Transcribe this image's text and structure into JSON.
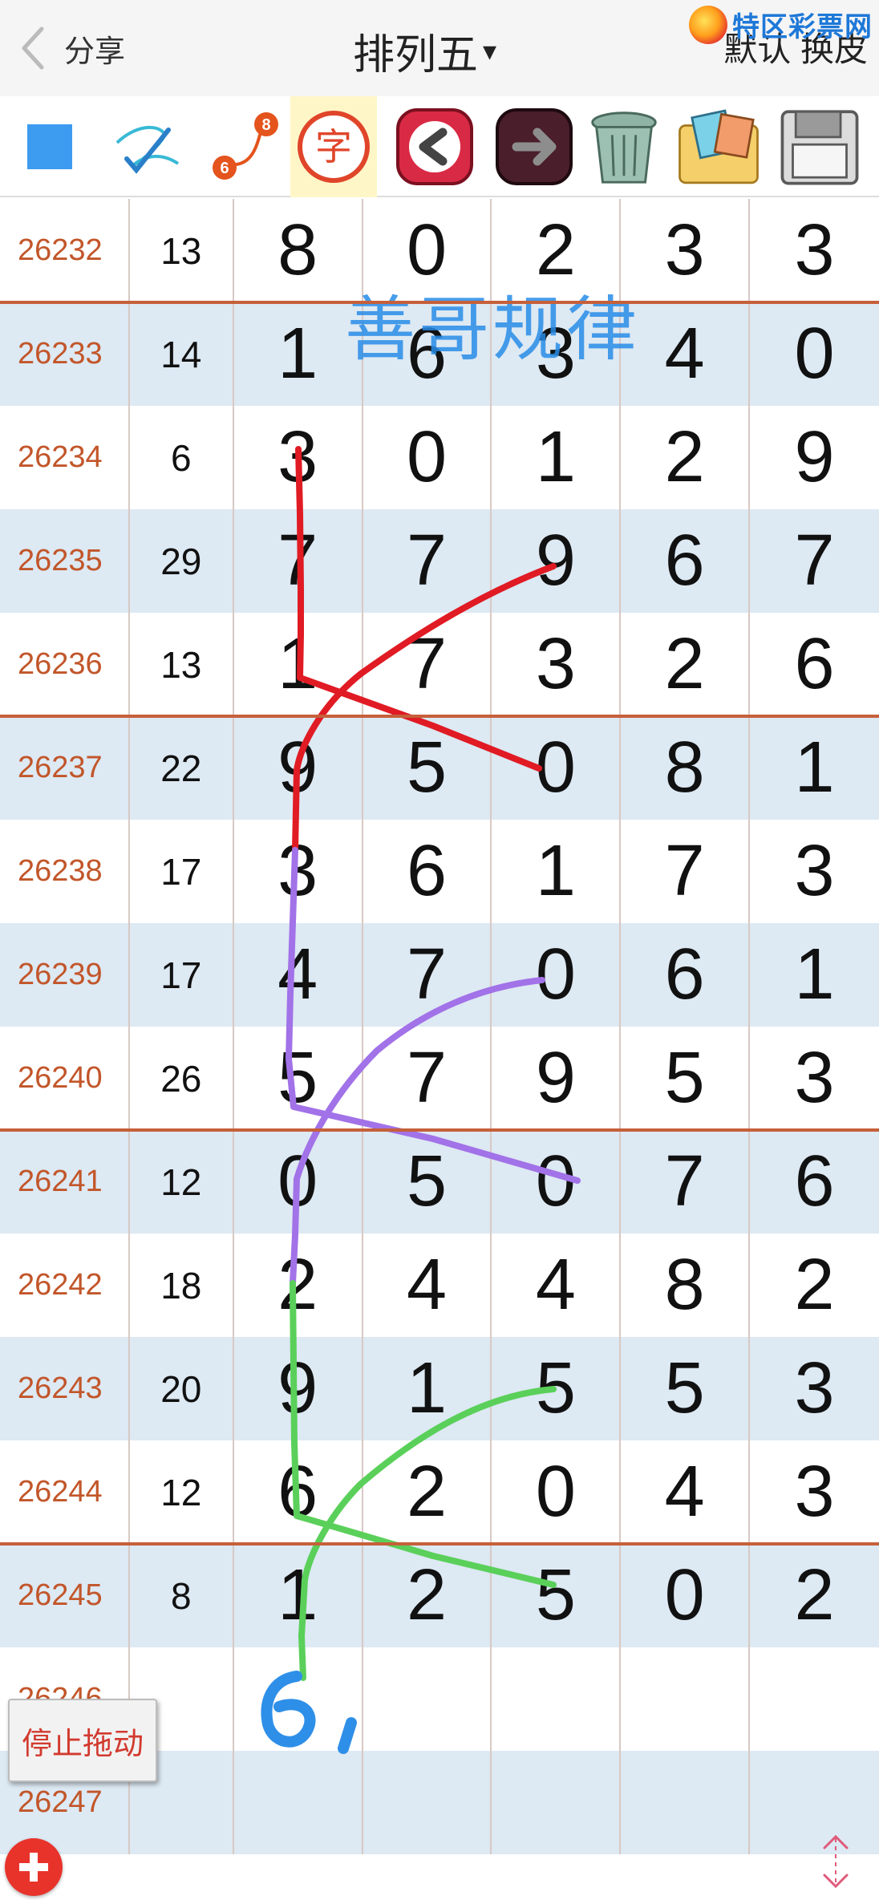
{
  "header": {
    "back_label": "分享",
    "title": "排列五",
    "title_caret": "▾",
    "theme_label": "默认 换皮",
    "watermark_text": "特区彩票网"
  },
  "toolbar": {
    "tools": [
      {
        "icon": "blue-square-icon"
      },
      {
        "icon": "pen-draw-icon"
      },
      {
        "icon": "connect-6-8-icon",
        "numbers": [
          "6",
          "8"
        ]
      },
      {
        "icon": "zi-character-icon",
        "label": "字",
        "active": true
      },
      {
        "icon": "undo-arrow-icon"
      },
      {
        "icon": "redo-arrow-icon"
      },
      {
        "icon": "trash-icon"
      },
      {
        "icon": "photos-folder-icon"
      },
      {
        "icon": "save-disk-icon"
      }
    ]
  },
  "overlay_title": "善哥规律",
  "handwritten_note": "61",
  "rows": [
    {
      "issue": "26232",
      "sum": "13",
      "digits": [
        "8",
        "0",
        "2",
        "3",
        "3"
      ]
    },
    {
      "issue": "26233",
      "sum": "14",
      "digits": [
        "1",
        "6",
        "3",
        "4",
        "0"
      ]
    },
    {
      "issue": "26234",
      "sum": "6",
      "digits": [
        "3",
        "0",
        "1",
        "2",
        "9"
      ]
    },
    {
      "issue": "26235",
      "sum": "29",
      "digits": [
        "7",
        "7",
        "9",
        "6",
        "7"
      ]
    },
    {
      "issue": "26236",
      "sum": "13",
      "digits": [
        "1",
        "7",
        "3",
        "2",
        "6"
      ]
    },
    {
      "issue": "26237",
      "sum": "22",
      "digits": [
        "9",
        "5",
        "0",
        "8",
        "1"
      ]
    },
    {
      "issue": "26238",
      "sum": "17",
      "digits": [
        "3",
        "6",
        "1",
        "7",
        "3"
      ]
    },
    {
      "issue": "26239",
      "sum": "17",
      "digits": [
        "4",
        "7",
        "0",
        "6",
        "1"
      ]
    },
    {
      "issue": "26240",
      "sum": "26",
      "digits": [
        "5",
        "7",
        "9",
        "5",
        "3"
      ]
    },
    {
      "issue": "26241",
      "sum": "12",
      "digits": [
        "0",
        "5",
        "0",
        "7",
        "6"
      ]
    },
    {
      "issue": "26242",
      "sum": "18",
      "digits": [
        "2",
        "4",
        "4",
        "8",
        "2"
      ]
    },
    {
      "issue": "26243",
      "sum": "20",
      "digits": [
        "9",
        "1",
        "5",
        "5",
        "3"
      ]
    },
    {
      "issue": "26244",
      "sum": "12",
      "digits": [
        "6",
        "2",
        "0",
        "4",
        "3"
      ]
    },
    {
      "issue": "26245",
      "sum": "8",
      "digits": [
        "1",
        "2",
        "5",
        "0",
        "2"
      ]
    },
    {
      "issue": "26246",
      "sum": "",
      "digits": [
        "",
        "",
        "",
        "",
        ""
      ]
    },
    {
      "issue": "26247",
      "sum": "",
      "digits": [
        "",
        "",
        "",
        "",
        ""
      ]
    }
  ],
  "stop_drag_label": "停止拖动",
  "colors": {
    "issue_text": "#c2562a",
    "alt_row": "#dde9f3",
    "divider": "#c6603a",
    "stroke_red": "#e01b24",
    "stroke_purple": "#a272e8",
    "stroke_green": "#5ad05a",
    "stroke_blue": "#2e8fe8"
  }
}
